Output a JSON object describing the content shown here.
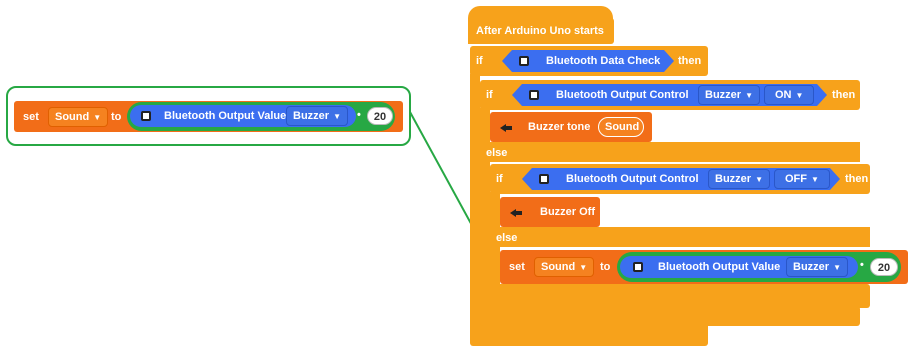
{
  "left_block": {
    "set_label": "set",
    "variable": "Sound",
    "to_label": "to",
    "value_reporter": "Bluetooth Output Value",
    "value_device": "Buzzer",
    "value_number": "20"
  },
  "program": {
    "hat_label": "After Arduino Uno starts",
    "if1_label": "if",
    "condition1": "Bluetooth Data Check",
    "then1": "then",
    "if2_label": "if",
    "condition2": "Bluetooth Output Control",
    "condition2_device": "Buzzer",
    "condition2_state": "ON",
    "then2": "then",
    "buzzer_tone_label": "Buzzer tone",
    "buzzer_tone_arg": "Sound",
    "else1": "else",
    "if3_label": "if",
    "condition3": "Bluetooth Output Control",
    "condition3_device": "Buzzer",
    "condition3_state": "OFF",
    "then3": "then",
    "buzzer_off_label": "Buzzer Off",
    "else2": "else",
    "set_label": "set",
    "variable": "Sound",
    "to_label": "to",
    "value_reporter": "Bluetooth Output Value",
    "value_device": "Buzzer",
    "value_number": "20"
  },
  "colors": {
    "control": "#f7a21b",
    "action": "#f26d18",
    "bluetooth": "#3b6ef0",
    "highlight": "#27a844"
  },
  "icons": {
    "bluetooth_module": "bluetooth-module-icon",
    "buzzer": "buzzer-icon"
  }
}
